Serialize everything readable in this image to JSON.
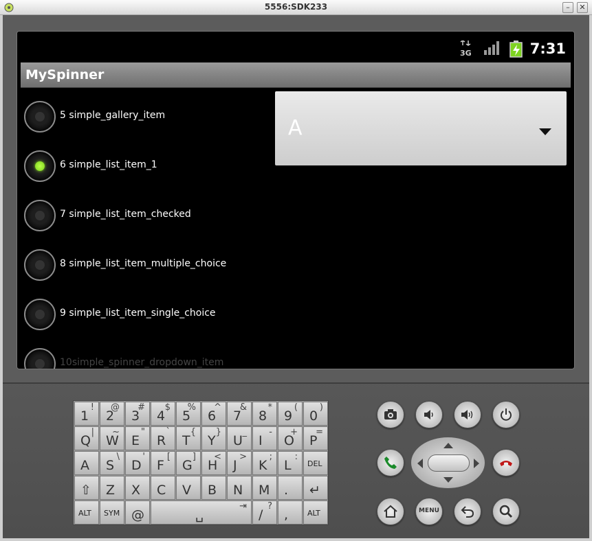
{
  "window": {
    "title": "5556:SDK233",
    "minimize_label": "–",
    "close_label": "✕"
  },
  "statusbar": {
    "network": "3G",
    "time": "7:31"
  },
  "app": {
    "title": "MySpinner"
  },
  "radio_list": [
    {
      "label": "5 simple_gallery_item",
      "checked": false
    },
    {
      "label": "6 simple_list_item_1",
      "checked": true
    },
    {
      "label": "7 simple_list_item_checked",
      "checked": false
    },
    {
      "label": "8 simple_list_item_multiple_choice",
      "checked": false
    },
    {
      "label": "9 simple_list_item_single_choice",
      "checked": false
    },
    {
      "label": "10simple_spinner_dropdown_item",
      "checked": false
    }
  ],
  "spinner": {
    "selected": "A"
  },
  "keyboard": {
    "row1": [
      {
        "m": "1",
        "s": "!"
      },
      {
        "m": "2",
        "s": "@"
      },
      {
        "m": "3",
        "s": "#"
      },
      {
        "m": "4",
        "s": "$"
      },
      {
        "m": "5",
        "s": "%"
      },
      {
        "m": "6",
        "s": "^"
      },
      {
        "m": "7",
        "s": "&"
      },
      {
        "m": "8",
        "s": "*"
      },
      {
        "m": "9",
        "s": "("
      },
      {
        "m": "0",
        "s": ")"
      }
    ],
    "row2": [
      {
        "m": "Q",
        "s": "|"
      },
      {
        "m": "W",
        "s": "~"
      },
      {
        "m": "E",
        "s": "\""
      },
      {
        "m": "R",
        "s": "`"
      },
      {
        "m": "T",
        "s": "{"
      },
      {
        "m": "Y",
        "s": "}"
      },
      {
        "m": "U",
        "s": "_"
      },
      {
        "m": "I",
        "s": "-"
      },
      {
        "m": "O",
        "s": "+"
      },
      {
        "m": "P",
        "s": "="
      }
    ],
    "row3": [
      {
        "m": "A",
        "s": ""
      },
      {
        "m": "S",
        "s": "\\"
      },
      {
        "m": "D",
        "s": "'"
      },
      {
        "m": "F",
        "s": "["
      },
      {
        "m": "G",
        "s": "]"
      },
      {
        "m": "H",
        "s": "<"
      },
      {
        "m": "J",
        "s": ">"
      },
      {
        "m": "K",
        "s": ";"
      },
      {
        "m": "L",
        "s": ":"
      },
      {
        "m": "DEL",
        "s": ""
      }
    ],
    "row4": [
      {
        "m": "⇧",
        "s": ""
      },
      {
        "m": "Z",
        "s": ""
      },
      {
        "m": "X",
        "s": ""
      },
      {
        "m": "C",
        "s": ""
      },
      {
        "m": "V",
        "s": ""
      },
      {
        "m": "B",
        "s": ""
      },
      {
        "m": "N",
        "s": ""
      },
      {
        "m": "M",
        "s": ""
      },
      {
        "m": ".",
        "s": ""
      },
      {
        "m": "↵",
        "s": ""
      }
    ],
    "row5": {
      "alt_left": "ALT",
      "sym": "SYM",
      "at": "@",
      "space": "␣",
      "tab": "⇥",
      "slash": "/",
      "slash_alt": "?",
      "comma": ",",
      "alt_right": "ALT"
    }
  },
  "hardware": {
    "menu_label": "MENU"
  }
}
